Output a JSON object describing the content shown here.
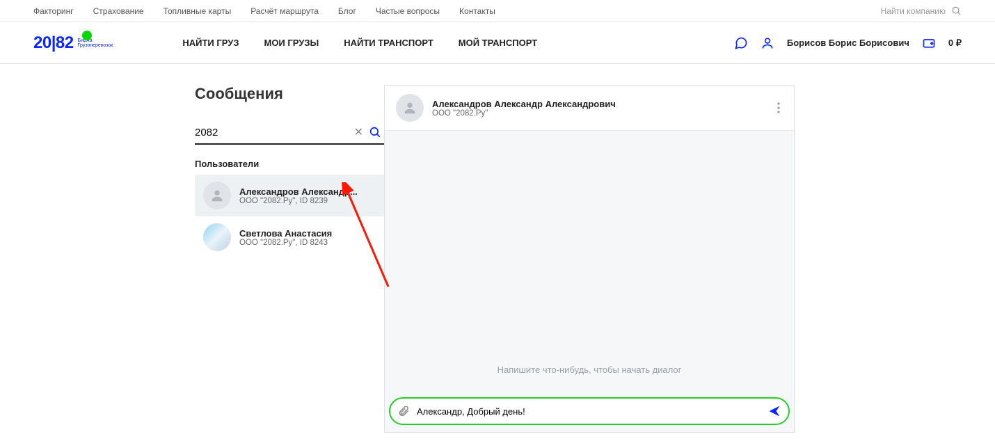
{
  "topnav": {
    "links": [
      "Факторинг",
      "Страхование",
      "Топливные карты",
      "Расчёт маршрута",
      "Блог",
      "Частые вопросы",
      "Контакты"
    ],
    "search_placeholder": "Найти компанию"
  },
  "logo": {
    "main": "20|82",
    "sub1": "Биржа",
    "sub2": "Грузоперевозок"
  },
  "nav": [
    "НАЙТИ ГРУЗ",
    "МОИ ГРУЗЫ",
    "НАЙТИ ТРАНСПОРТ",
    "МОЙ ТРАНСПОРТ"
  ],
  "user": {
    "name": "Борисов Борис Борисович",
    "balance": "0 ₽"
  },
  "page": {
    "title": "Сообщения"
  },
  "search": {
    "value": "2082"
  },
  "section": {
    "users_label": "Пользователи"
  },
  "users": [
    {
      "name": "Александров Александр...",
      "sub": "ООО \"2082.Ру\", ID 8239"
    },
    {
      "name": "Светлова Анастасия",
      "sub": "ООО \"2082.Ру\", ID 8243"
    }
  ],
  "chat": {
    "contact_name": "Александров Александр Александрович",
    "contact_sub": "ООО \"2082.Ру\"",
    "empty": "Напишите что-нибудь, чтобы начать диалог",
    "compose_value": "Александр, Добрый день!"
  }
}
